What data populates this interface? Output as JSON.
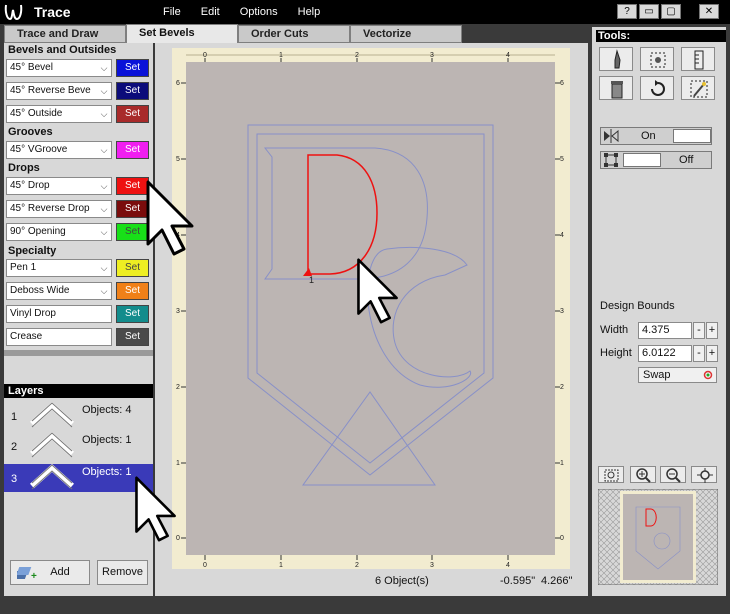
{
  "app": {
    "title": "Trace"
  },
  "menu": [
    "File",
    "Edit",
    "Options",
    "Help"
  ],
  "window_controls": [
    "?",
    "▭",
    "▢",
    "✕"
  ],
  "tabs": [
    {
      "label": "Trace and Draw",
      "active": false
    },
    {
      "label": "Set Bevels",
      "active": true
    },
    {
      "label": "Order Cuts",
      "active": false
    },
    {
      "label": "Vectorize",
      "active": false
    }
  ],
  "bevels": {
    "sections": {
      "bevels_outsides": "Bevels and Outsides",
      "grooves": "Grooves",
      "drops": "Drops",
      "specialty": "Specialty"
    },
    "rows": [
      {
        "value": "45° Bevel",
        "dropdown": true,
        "set_label": "Set",
        "color": "#0a12d8"
      },
      {
        "value": "45° Reverse Beve",
        "dropdown": true,
        "set_label": "Set",
        "color": "#0c0c7a"
      },
      {
        "value": "45° Outside",
        "dropdown": true,
        "set_label": "Set",
        "color": "#a82a2a"
      },
      {
        "value": "45° VGroove",
        "dropdown": true,
        "set_label": "Set",
        "color": "#f01ef0"
      },
      {
        "value": "45° Drop",
        "dropdown": true,
        "set_label": "Set",
        "color": "#ee1111"
      },
      {
        "value": "45° Reverse Drop",
        "dropdown": true,
        "set_label": "Set",
        "color": "#7a0c0c"
      },
      {
        "value": "90° Opening",
        "dropdown": true,
        "set_label": "Set",
        "color": "#18e018"
      },
      {
        "value": "Pen 1",
        "dropdown": true,
        "set_label": "Set",
        "color": "#eeee22"
      },
      {
        "value": "Deboss Wide",
        "dropdown": true,
        "set_label": "Set",
        "color": "#f08018"
      },
      {
        "value": "Vinyl Drop",
        "dropdown": false,
        "set_label": "Set",
        "color": "#138c8c"
      },
      {
        "value": "Crease",
        "dropdown": false,
        "set_label": "Set",
        "color": "#4a4a4a"
      }
    ]
  },
  "layers": {
    "title": "Layers",
    "items": [
      {
        "number": "1",
        "objects": "Objects: 4",
        "selected": false
      },
      {
        "number": "2",
        "objects": "Objects: 1",
        "selected": false
      },
      {
        "number": "3",
        "objects": "Objects: 1",
        "selected": true
      }
    ],
    "add_label": "Add",
    "remove_label": "Remove"
  },
  "canvas": {
    "ruler_top": [
      "0",
      "1",
      "2",
      "3",
      "4"
    ],
    "ruler_side": [
      "6",
      "5",
      "4",
      "3",
      "2",
      "1",
      "0"
    ],
    "node_label": "1",
    "status_objects": "6 Object(s)",
    "status_x": "-0.595\"",
    "status_y": "4.266\""
  },
  "tools": {
    "title": "Tools:",
    "icons": [
      "knife-icon",
      "select-nodes-icon",
      "ruler-icon",
      "trash-icon",
      "rotate-icon",
      "magic-select-icon"
    ],
    "toggle1": {
      "state": "On"
    },
    "toggle2": {
      "state": "Off"
    },
    "design_bounds_label": "Design Bounds",
    "width_label": "Width",
    "width_value": "4.375",
    "height_label": "Height",
    "height_value": "6.0122",
    "swap_label": "Swap",
    "minus": "-",
    "plus": "+"
  }
}
